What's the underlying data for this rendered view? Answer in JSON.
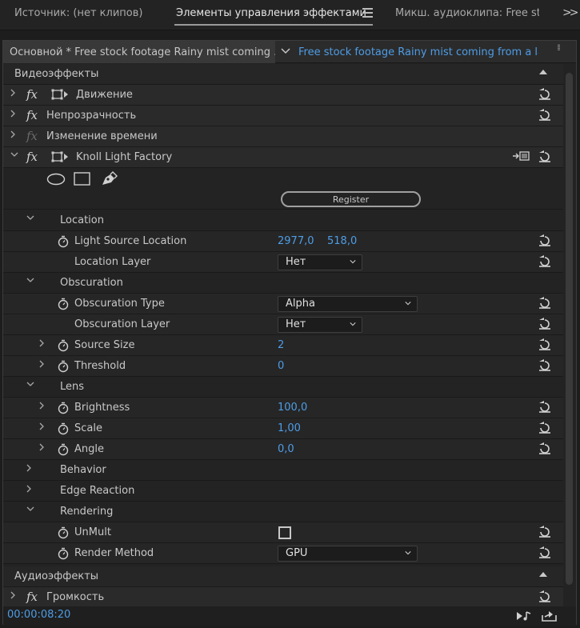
{
  "tabs": {
    "source": "Источник: (нет клипов)",
    "effect_controls": "Элементы управления эффектами",
    "audio_mixer": "Микш. аудиоклипа: Free sto"
  },
  "clip_selector": {
    "master": "Основной * Free stock footage Rainy mist coming ...",
    "sequence": "Free stock footage Rainy mist coming from a la..."
  },
  "sections": {
    "video_effects": "Видеоэффекты",
    "audio_effects": "Аудиоэффекты"
  },
  "effects": {
    "motion": "Движение",
    "opacity": "Непрозрачность",
    "time_remap": "Изменение времени",
    "knoll": "Knoll Light Factory",
    "volume": "Громкость"
  },
  "knoll": {
    "register": "Register",
    "groups": {
      "location": "Location",
      "obscuration": "Obscuration",
      "lens": "Lens",
      "behavior": "Behavior",
      "edge_reaction": "Edge Reaction",
      "rendering": "Rendering"
    },
    "props": {
      "light_source_location": {
        "label": "Light Source Location",
        "x": "2977,0",
        "y": "518,0"
      },
      "location_layer": {
        "label": "Location Layer",
        "value": "Нет"
      },
      "obscuration_type": {
        "label": "Obscuration Type",
        "value": "Alpha"
      },
      "obscuration_layer": {
        "label": "Obscuration Layer",
        "value": "Нет"
      },
      "source_size": {
        "label": "Source Size",
        "value": "2"
      },
      "threshold": {
        "label": "Threshold",
        "value": "0"
      },
      "brightness": {
        "label": "Brightness",
        "value": "100,0"
      },
      "scale": {
        "label": "Scale",
        "value": "1,00"
      },
      "angle": {
        "label": "Angle",
        "value": "0,0"
      },
      "unmult": {
        "label": "UnMult",
        "checked": false
      },
      "render_method": {
        "label": "Render Method",
        "value": "GPU"
      }
    }
  },
  "footer": {
    "timecode": "00:00:08:20"
  },
  "colors": {
    "accent_blue": "#4e9de6",
    "panel_bg": "#232323"
  }
}
